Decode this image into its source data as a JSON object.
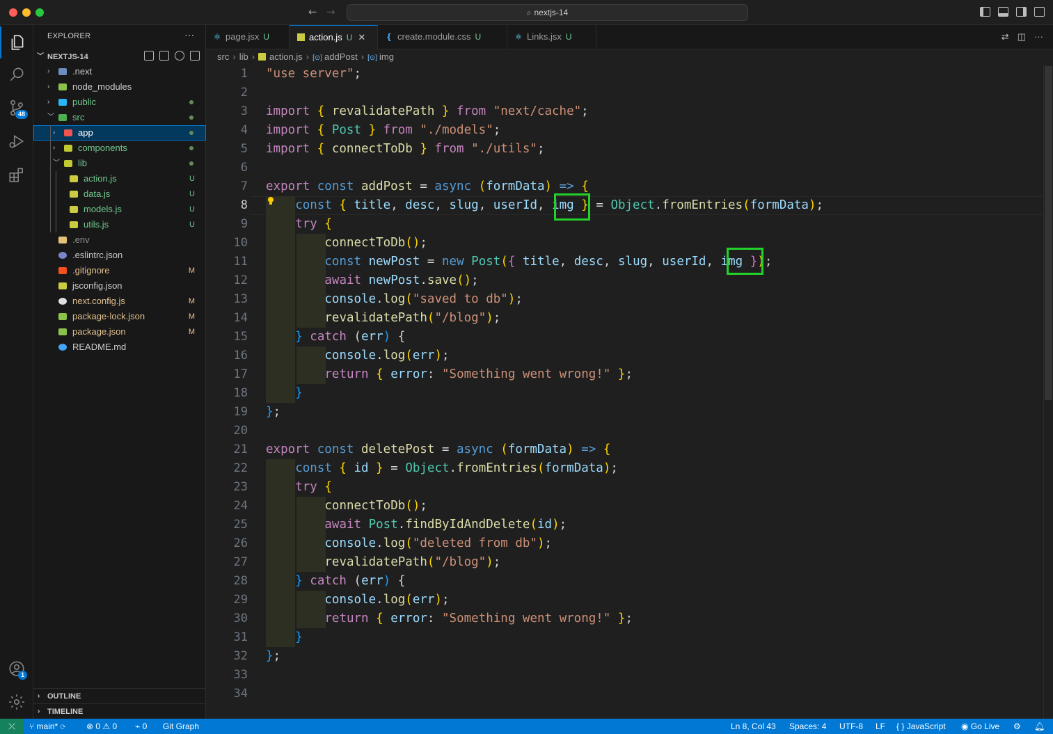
{
  "window": {
    "search_text": "nextjs-14"
  },
  "activity": {
    "source_control_badge": "48",
    "account_badge": "1"
  },
  "sidebar": {
    "title": "EXPLORER",
    "more": "···",
    "root": "NEXTJS-14",
    "items": [
      {
        "label": ".next",
        "status": "",
        "color": "#cccccc"
      },
      {
        "label": "node_modules",
        "status": "",
        "color": "#cccccc"
      },
      {
        "label": "public",
        "status": "dot",
        "color": "#73c991"
      },
      {
        "label": "src",
        "status": "dot",
        "color": "#73c991"
      },
      {
        "label": "app",
        "status": "dot",
        "color": "#ffffff"
      },
      {
        "label": "components",
        "status": "dot",
        "color": "#73c991"
      },
      {
        "label": "lib",
        "status": "dot",
        "color": "#73c991"
      },
      {
        "label": "action.js",
        "status": "U",
        "color": "#73c991"
      },
      {
        "label": "data.js",
        "status": "U",
        "color": "#73c991"
      },
      {
        "label": "models.js",
        "status": "U",
        "color": "#73c991"
      },
      {
        "label": "utils.js",
        "status": "U",
        "color": "#73c991"
      },
      {
        "label": ".env",
        "status": "",
        "color": "#8c8c8c"
      },
      {
        "label": ".eslintrc.json",
        "status": "",
        "color": "#cccccc"
      },
      {
        "label": ".gitignore",
        "status": "M",
        "color": "#e2c08d"
      },
      {
        "label": "jsconfig.json",
        "status": "",
        "color": "#cccccc"
      },
      {
        "label": "next.config.js",
        "status": "M",
        "color": "#e2c08d"
      },
      {
        "label": "package-lock.json",
        "status": "M",
        "color": "#e2c08d"
      },
      {
        "label": "package.json",
        "status": "M",
        "color": "#e2c08d"
      },
      {
        "label": "README.md",
        "status": "",
        "color": "#cccccc"
      }
    ],
    "outline": "OUTLINE",
    "timeline": "TIMELINE"
  },
  "tabs": [
    {
      "label": "page.jsx",
      "status": "U",
      "icon": "react-icon"
    },
    {
      "label": "action.js",
      "status": "U",
      "icon": "js-icon",
      "active": true
    },
    {
      "label": "create.module.css",
      "status": "U",
      "icon": "css-icon"
    },
    {
      "label": "Links.jsx",
      "status": "U",
      "icon": "react-icon"
    }
  ],
  "breadcrumb": [
    "src",
    "lib",
    "action.js",
    "addPost",
    "img"
  ],
  "editor": {
    "current_line": 8,
    "lines": [
      "\"use server\";",
      "",
      "import { revalidatePath } from \"next/cache\";",
      "import { Post } from \"./models\";",
      "import { connectToDb } from \"./utils\";",
      "",
      "export const addPost = async (formData) => {",
      "  const { title, desc, slug, userId, img } = Object.fromEntries(formData);",
      "  try {",
      "    connectToDb();",
      "    const newPost = new Post({ title, desc, slug, userId, img });",
      "    await newPost.save();",
      "    console.log(\"saved to db\");",
      "    revalidatePath(\"/blog\");",
      "  } catch (err) {",
      "    console.log(err);",
      "    return { error: \"Something went wrong!\" };",
      "  }",
      "};",
      "",
      "export const deletePost = async (formData) => {",
      "  const { id } = Object.fromEntries(formData);",
      "  try {",
      "    connectToDb();",
      "    await Post.findByIdAndDelete(id);",
      "    console.log(\"deleted from db\");",
      "    revalidatePath(\"/blog\");",
      "  } catch (err) {",
      "    console.log(err);",
      "    return { error: \"Something went wrong!\" };",
      "  }",
      "};",
      "",
      ""
    ]
  },
  "statusbar": {
    "branch": "main*",
    "errors": "0",
    "warnings": "0",
    "ports": "0",
    "git_graph": "Git Graph",
    "position": "Ln 8, Col 43",
    "spaces": "Spaces: 4",
    "encoding": "UTF-8",
    "eol": "LF",
    "language": "JavaScript",
    "go_live": "Go Live"
  }
}
